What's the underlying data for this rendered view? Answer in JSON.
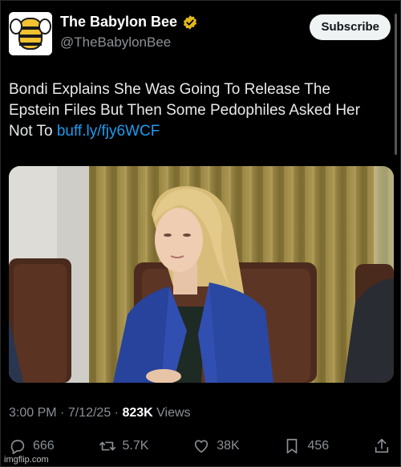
{
  "account": {
    "display_name": "The Babylon Bee",
    "handle": "@TheBabylonBee",
    "verified": true
  },
  "header": {
    "subscribe_label": "Subscribe"
  },
  "tweet": {
    "text": "Bondi Explains She Was Going To Release The Epstein Files But Then Some Pedophiles Asked Her Not To ",
    "link": "buff.ly/fjy6WCF"
  },
  "meta": {
    "time": "3:00 PM",
    "separator": "·",
    "date": "7/12/25",
    "views_count": "823K",
    "views_label": "Views"
  },
  "actions": {
    "replies": "666",
    "reposts": "5.7K",
    "likes": "38K",
    "bookmarks": "456"
  },
  "watermark": "imgflip.com",
  "colors": {
    "link": "#1d9bf0",
    "verified": "#e2b719",
    "background": "#000000"
  }
}
